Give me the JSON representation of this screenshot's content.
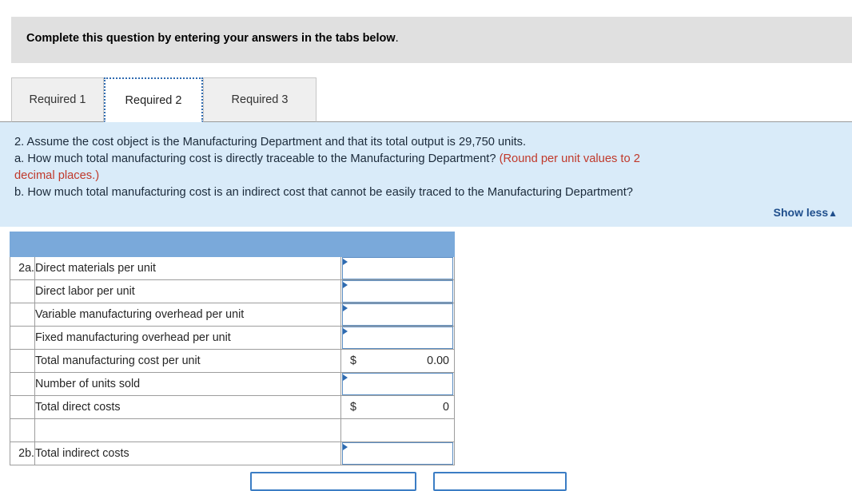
{
  "instruction": {
    "bold_part": "Complete this question by entering your answers in the tabs below",
    "tail": "."
  },
  "tabs": [
    {
      "label": "Required 1",
      "active": false
    },
    {
      "label": "Required 2",
      "active": true
    },
    {
      "label": "Required 3",
      "active": false
    }
  ],
  "question": {
    "line1": "2. Assume the cost object is the Manufacturing Department and that its total output is 29,750 units.",
    "line2_black": "a. How much total manufacturing cost is directly traceable to the Manufacturing Department? ",
    "line2_red": "(Round per unit values to 2",
    "line3_red": "decimal places.)",
    "line4": "b. How much total manufacturing cost is an indirect cost that cannot be easily traced to the Manufacturing Department?",
    "show_less_label": "Show less",
    "show_less_caret": "▲"
  },
  "table": {
    "header": {
      "num": "",
      "label": "",
      "value": ""
    },
    "rows": [
      {
        "num": "2a.",
        "label": "Direct materials per unit",
        "type": "input",
        "currency": "",
        "amount": ""
      },
      {
        "num": "",
        "label": "Direct labor per unit",
        "type": "input",
        "currency": "",
        "amount": ""
      },
      {
        "num": "",
        "label": "Variable manufacturing overhead per unit",
        "type": "input",
        "currency": "",
        "amount": ""
      },
      {
        "num": "",
        "label": "Fixed manufacturing overhead per unit",
        "type": "input",
        "currency": "",
        "amount": ""
      },
      {
        "num": "",
        "label": "Total manufacturing cost per unit",
        "type": "value",
        "currency": "$",
        "amount": "0.00"
      },
      {
        "num": "",
        "label": "Number of units sold",
        "type": "input",
        "currency": "",
        "amount": ""
      },
      {
        "num": "",
        "label": "Total direct costs",
        "type": "value",
        "currency": "$",
        "amount": "0"
      },
      {
        "num": "",
        "label": "",
        "type": "empty",
        "currency": "",
        "amount": ""
      },
      {
        "num": "2b.",
        "label": "Total indirect costs",
        "type": "input",
        "currency": "",
        "amount": ""
      }
    ]
  },
  "footer_buttons": [
    {
      "label": ""
    },
    {
      "label": ""
    }
  ],
  "colors": {
    "banner_gray": "#e0e0e0",
    "panel_blue": "#d9ebf9",
    "table_header_blue": "#7aa9da",
    "input_border_blue": "#5b8ec4",
    "link_blue": "#1f4e8c",
    "alert_red": "#c0392b",
    "button_blue": "#3b7dc4"
  }
}
